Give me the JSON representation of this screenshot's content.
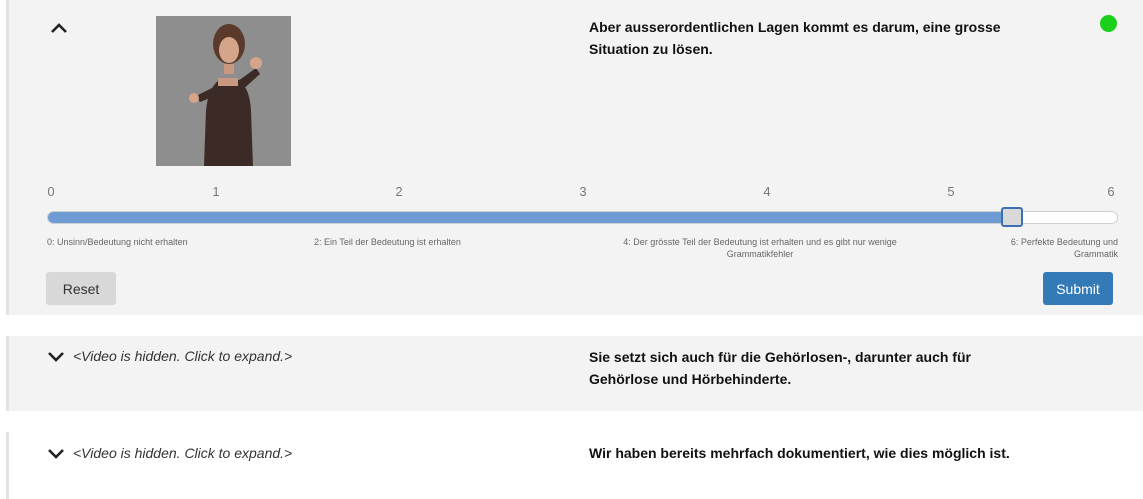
{
  "item1": {
    "sentence": "Aber ausserordentlichen Lagen kommt es darum, eine grosse Situation zu lösen.",
    "status_color": "#19d119",
    "slider": {
      "min": 0,
      "max": 6,
      "value": 5.4,
      "ticks": [
        "0",
        "1",
        "2",
        "3",
        "4",
        "5",
        "6"
      ],
      "descriptions": {
        "d0": "0: Unsinn/Bedeutung nicht erhalten",
        "d2": "2: Ein Teil der Bedeutung ist erhalten",
        "d4": "4: Der grösste Teil der Bedeutung ist erhalten und es gibt nur wenige Grammatikfehler",
        "d6": "6: Perfekte Bedeutung und Grammatik"
      }
    },
    "reset_label": "Reset",
    "submit_label": "Submit"
  },
  "item2": {
    "hidden_note": "<Video is hidden. Click to expand.>",
    "sentence": "Sie setzt sich auch für die Gehörlosen-, darunter auch für Gehörlose und Hörbehinderte."
  },
  "item3": {
    "hidden_note": "<Video is hidden. Click to expand.>",
    "sentence": "Wir haben bereits mehrfach dokumentiert, wie dies möglich ist."
  },
  "icons": {
    "collapse": "chevron-up-icon",
    "expand": "chevron-down-icon",
    "status": "status-dot"
  }
}
